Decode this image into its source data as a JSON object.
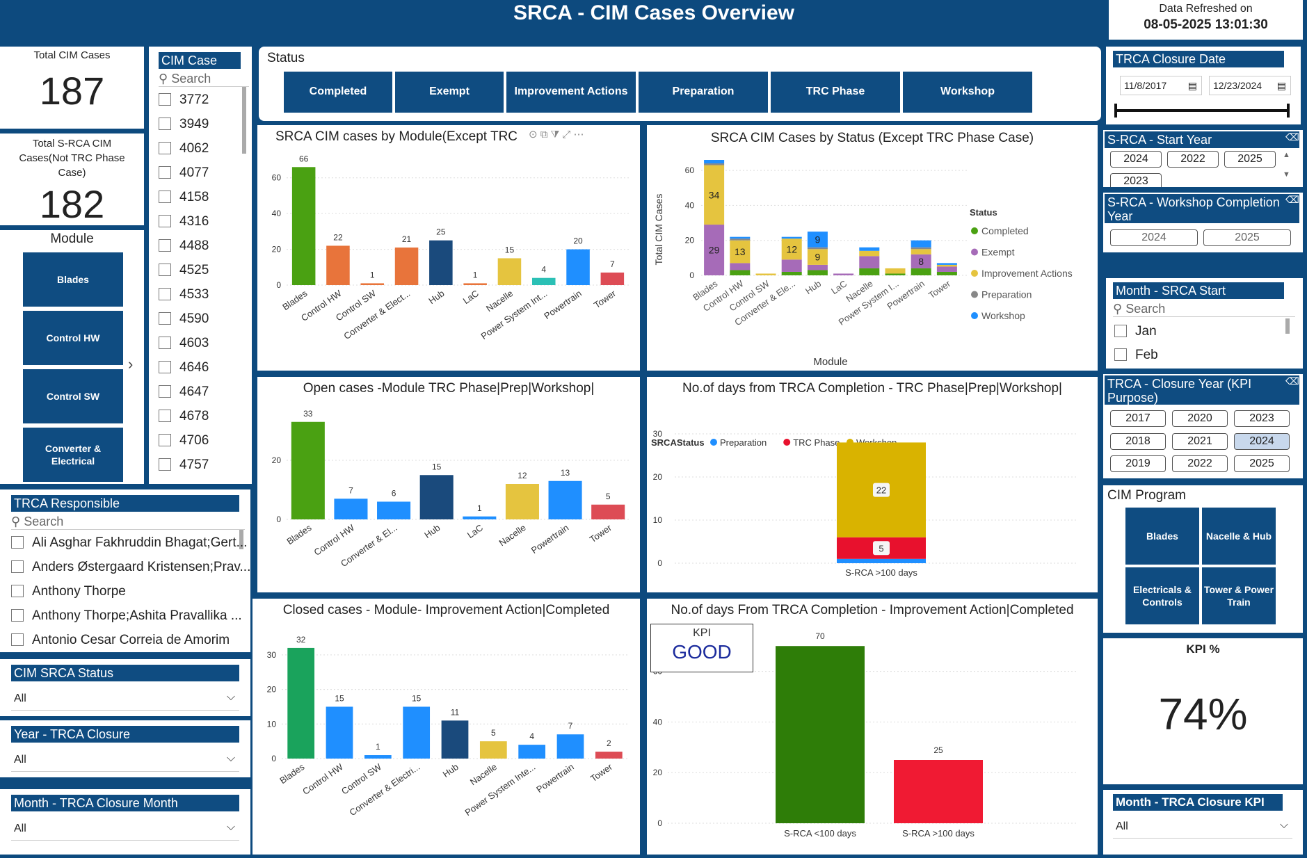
{
  "header": {
    "title": "SRCA - CIM Cases Overview",
    "refresh_label": "Data Refreshed on",
    "refresh_value": "08-05-2025 13:01:30"
  },
  "kpis": {
    "total_label": "Total CIM Cases",
    "total_value": "187",
    "srca_label": "Total S-RCA CIM Cases(Not TRC Phase Case)",
    "srca_value": "182",
    "kpi_pct_label": "KPI %",
    "kpi_pct_value": "74%",
    "kpi_card_label": "KPI",
    "kpi_card_value": "GOOD"
  },
  "module_slicer": {
    "title": "Module",
    "items": [
      "Blades",
      "Control HW",
      "Control SW",
      "Converter & Electrical"
    ],
    "chevron": "chevron-right-icon"
  },
  "cim_case_slicer": {
    "title": "CIM Case",
    "search": "Search",
    "items": [
      "3772",
      "3949",
      "4062",
      "4077",
      "4158",
      "4316",
      "4488",
      "4525",
      "4533",
      "4590",
      "4603",
      "4646",
      "4647",
      "4678",
      "4706",
      "4757"
    ]
  },
  "status_slicer": {
    "title": "Status",
    "items": [
      "Completed",
      "Exempt",
      "Improvement Actions",
      "Preparation",
      "TRC Phase",
      "Workshop"
    ]
  },
  "trca_closure_date": {
    "title": "TRCA Closure Date",
    "start": "11/8/2017",
    "end": "12/23/2024"
  },
  "start_year": {
    "title": "S-RCA - Start Year",
    "items": [
      "2024",
      "2022",
      "2025",
      "2023"
    ]
  },
  "workshop_year": {
    "title": "S-RCA - Workshop Completion Year",
    "items": [
      "2024",
      "2025"
    ]
  },
  "month_srca": {
    "title": "Month - SRCA Start",
    "search": "Search",
    "items": [
      "Jan",
      "Feb"
    ]
  },
  "closure_year_kpi": {
    "title": "TRCA - Closure Year (KPI Purpose)",
    "items": [
      "2017",
      "2020",
      "2023",
      "2018",
      "2021",
      "2024",
      "2019",
      "2022",
      "2025"
    ],
    "selected": "2024"
  },
  "cim_program": {
    "title": "CIM Program",
    "items": [
      "Blades",
      "Nacelle & Hub",
      "Electricals & Controls",
      "Tower & Power Train"
    ]
  },
  "month_kpi": {
    "title": "Month - TRCA Closure KPI",
    "value": "All"
  },
  "trca_responsible": {
    "title": "TRCA Responsible",
    "search": "Search",
    "items": [
      "Ali Asghar Fakhruddin Bhagat;Gert...",
      "Anders Østergaard Kristensen;Prav...",
      "Anthony Thorpe",
      "Anthony Thorpe;Ashita Pravallika ...",
      "Antonio Cesar Correia de Amorim"
    ]
  },
  "cim_srca_status": {
    "title": "CIM SRCA Status",
    "value": "All"
  },
  "year_trca": {
    "title": "Year - TRCA Closure",
    "value": "All"
  },
  "month_trca": {
    "title": "Month - TRCA Closure Month",
    "value": "All"
  },
  "colors": {
    "navy": "#0f4c81",
    "green": "#4aa112",
    "orange": "#e8743b",
    "darknavy": "#1a4a7c",
    "yellow": "#e5c43f",
    "teal": "#2bc0b5",
    "blue": "#1f8fff",
    "red": "#dd4c55",
    "purple": "#a66bb8",
    "grey": "#888888"
  },
  "chart_data": [
    {
      "id": "c1",
      "type": "bar",
      "title": "SRCA CIM cases by Module(Except TRC",
      "categories": [
        "Blades",
        "Control HW",
        "Control SW",
        "Converter & Elect...",
        "Hub",
        "LaC",
        "Nacelle",
        "Power System Int...",
        "Powertrain",
        "Tower"
      ],
      "values": [
        66,
        22,
        1,
        21,
        25,
        1,
        15,
        4,
        20,
        7
      ],
      "yticks": [
        0,
        20,
        40,
        60
      ],
      "ylim": [
        0,
        70
      ]
    },
    {
      "id": "c2",
      "type": "bar",
      "stacked": true,
      "title": "SRCA CIM Cases by Status (Except TRC Phase Case)",
      "ylabel": "Total CIM Cases",
      "xlabel": "Module",
      "legend_title": "Status",
      "categories": [
        "Blades",
        "Control HW",
        "Control SW",
        "Converter & Ele...",
        "Hub",
        "LaC",
        "Nacelle",
        "Power System I...",
        "Powertrain",
        "Tower"
      ],
      "series": [
        {
          "name": "Completed",
          "values": [
            0,
            3,
            0,
            2,
            3,
            0,
            4,
            1,
            4,
            2
          ]
        },
        {
          "name": "Exempt",
          "values": [
            29,
            4,
            0,
            7,
            3,
            1,
            7,
            0,
            8,
            3
          ]
        },
        {
          "name": "Improvement Actions",
          "values": [
            34,
            13,
            1,
            12,
            9,
            0,
            3,
            3,
            3,
            1
          ]
        },
        {
          "name": "Preparation",
          "values": [
            1,
            1,
            0,
            0,
            1,
            0,
            0,
            0,
            1,
            0
          ]
        },
        {
          "name": "Workshop",
          "values": [
            2,
            1,
            0,
            1,
            9,
            0,
            2,
            0,
            4,
            1
          ]
        }
      ],
      "yticks": [
        0,
        20,
        40,
        60
      ],
      "ylim": [
        0,
        66
      ]
    },
    {
      "id": "c3",
      "type": "bar",
      "title": "Open cases -Module TRC Phase|Prep|Workshop|",
      "categories": [
        "Blades",
        "Control HW",
        "Converter & El...",
        "Hub",
        "LaC",
        "Nacelle",
        "Powertrain",
        "Tower"
      ],
      "values": [
        33,
        7,
        6,
        15,
        1,
        12,
        13,
        5
      ],
      "yticks": [
        0,
        20
      ],
      "ylim": [
        0,
        36
      ]
    },
    {
      "id": "c4",
      "type": "bar",
      "stacked": true,
      "title": "No.of days from TRCA Completion - TRC Phase|Prep|Workshop|",
      "legend_title": "SRCAStatus",
      "categories": [
        "S-RCA >100 days"
      ],
      "series": [
        {
          "name": "Preparation",
          "values": [
            1
          ]
        },
        {
          "name": "TRC Phase",
          "values": [
            5
          ]
        },
        {
          "name": "Workshop",
          "values": [
            22
          ]
        }
      ],
      "yticks": [
        0,
        10,
        20,
        30
      ],
      "ylim": [
        0,
        30
      ]
    },
    {
      "id": "c5",
      "type": "bar",
      "title": "Closed cases - Module- Improvement Action|Completed",
      "categories": [
        "Blades",
        "Control HW",
        "Control SW",
        "Converter & Electri...",
        "Hub",
        "Nacelle",
        "Power System Inte...",
        "Powertrain",
        "Tower"
      ],
      "values": [
        32,
        15,
        1,
        15,
        11,
        5,
        4,
        7,
        2
      ],
      "yticks": [
        0,
        10,
        20,
        30
      ],
      "ylim": [
        0,
        35
      ]
    },
    {
      "id": "c6",
      "type": "bar",
      "title": "No.of days From TRCA Completion - Improvement Action|Completed",
      "categories": [
        "S-RCA <100 days",
        "S-RCA >100 days"
      ],
      "values": [
        70,
        25
      ],
      "yticks": [
        0,
        20,
        40,
        60
      ],
      "ylim": [
        0,
        75
      ]
    }
  ]
}
